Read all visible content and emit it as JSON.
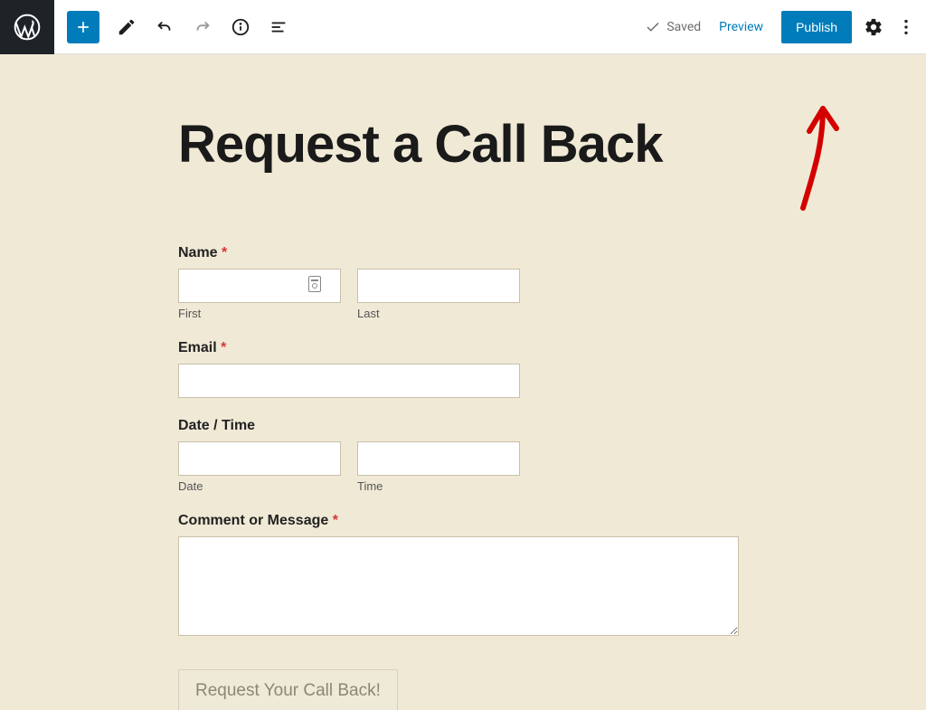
{
  "toolbar": {
    "saved_label": "Saved",
    "preview_label": "Preview",
    "publish_label": "Publish"
  },
  "page": {
    "title": "Request a Call Back"
  },
  "form": {
    "name_label": "Name",
    "name_first_sublabel": "First",
    "name_last_sublabel": "Last",
    "email_label": "Email",
    "datetime_label": "Date / Time",
    "date_sublabel": "Date",
    "time_sublabel": "Time",
    "comment_label": "Comment or Message",
    "required_marker": "*",
    "submit_label": "Request Your Call Back!"
  },
  "colors": {
    "accent": "#007cba",
    "canvas_bg": "#f0e9d6",
    "required": "#d63638"
  }
}
